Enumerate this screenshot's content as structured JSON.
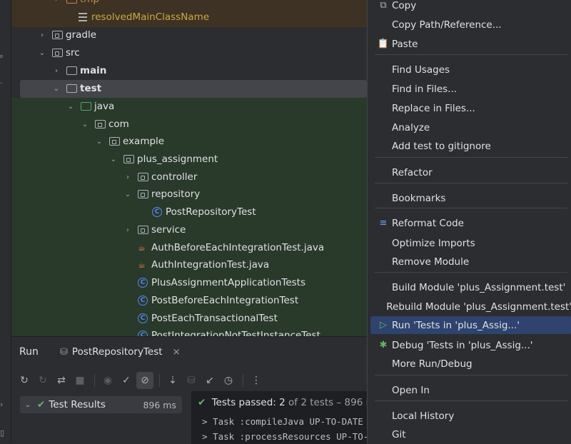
{
  "project_tree": {
    "rows": [
      {
        "name": "tree-row-tmp",
        "label": "tmp",
        "chev": "›",
        "icon": "folder-orange",
        "style": "orange"
      },
      {
        "name": "tree-row-resolvedmainclassname",
        "label": "resolvedMainClassName",
        "chev": "",
        "icon": "lines",
        "style": "yellow"
      },
      {
        "name": "tree-row-gradle",
        "label": "gradle",
        "chev": "›",
        "icon": "folder",
        "style": ""
      },
      {
        "name": "tree-row-src",
        "label": "src",
        "chev": "⌄",
        "icon": "folder",
        "style": ""
      },
      {
        "name": "tree-row-main",
        "label": "main",
        "chev": "›",
        "icon": "folder-plain",
        "style": "bold"
      },
      {
        "name": "tree-row-test",
        "label": "test",
        "chev": "⌄",
        "icon": "folder-plain",
        "style": "bold"
      },
      {
        "name": "tree-row-java",
        "label": "java",
        "chev": "⌄",
        "icon": "folder-green",
        "style": ""
      },
      {
        "name": "tree-row-com",
        "label": "com",
        "chev": "⌄",
        "icon": "folder",
        "style": ""
      },
      {
        "name": "tree-row-example",
        "label": "example",
        "chev": "⌄",
        "icon": "folder",
        "style": ""
      },
      {
        "name": "tree-row-plus-assignment",
        "label": "plus_assignment",
        "chev": "⌄",
        "icon": "folder",
        "style": ""
      },
      {
        "name": "tree-row-controller",
        "label": "controller",
        "chev": "›",
        "icon": "folder",
        "style": ""
      },
      {
        "name": "tree-row-repository",
        "label": "repository",
        "chev": "⌄",
        "icon": "folder",
        "style": ""
      },
      {
        "name": "tree-row-postrepositorytest",
        "label": "PostRepositoryTest",
        "chev": "",
        "icon": "class",
        "style": ""
      },
      {
        "name": "tree-row-service",
        "label": "service",
        "chev": "›",
        "icon": "folder",
        "style": ""
      },
      {
        "name": "tree-row-authbeforeeach",
        "label": "AuthBeforeEachIntegrationTest.java",
        "chev": "",
        "icon": "java",
        "style": ""
      },
      {
        "name": "tree-row-authintegration",
        "label": "AuthIntegrationTest.java",
        "chev": "",
        "icon": "java",
        "style": ""
      },
      {
        "name": "tree-row-plusassignmentapp",
        "label": "PlusAssignmentApplicationTests",
        "chev": "",
        "icon": "class",
        "style": ""
      },
      {
        "name": "tree-row-postbeforeeach",
        "label": "PostBeforeEachIntegrationTest",
        "chev": "",
        "icon": "class",
        "style": ""
      },
      {
        "name": "tree-row-posteachtransactional",
        "label": "PostEachTransactionalTest",
        "chev": "",
        "icon": "class",
        "style": ""
      },
      {
        "name": "tree-row-postintegrationnottest",
        "label": "PostIntegrationNotTestInstanceTest",
        "chev": "",
        "icon": "class",
        "style": ""
      }
    ]
  },
  "run_panel": {
    "title": "Run",
    "tab_label": "PostRepositoryTest",
    "test_results_label": "Test Results",
    "test_results_time": "896 ms",
    "passed_label": "Tests passed:",
    "passed_count": "2",
    "passed_rest": "of 2 tests – 896 ms",
    "console_lines": [
      "> Task :compileJava UP-TO-DATE",
      "> Task :processResources UP-TO-DATE"
    ]
  },
  "context_menu": {
    "items": [
      {
        "name": "menu-copy",
        "label": "Copy",
        "icon": "⧉"
      },
      {
        "name": "menu-copy-path",
        "label": "Copy Path/Reference...",
        "icon": ""
      },
      {
        "name": "menu-paste",
        "label": "Paste",
        "icon": "📋"
      },
      {
        "name": "menu-find-usages",
        "label": "Find Usages",
        "icon": ""
      },
      {
        "name": "menu-find-in-files",
        "label": "Find in Files...",
        "icon": ""
      },
      {
        "name": "menu-replace-in-files",
        "label": "Replace in Files...",
        "icon": ""
      },
      {
        "name": "menu-analyze",
        "label": "Analyze",
        "icon": ""
      },
      {
        "name": "menu-add-gitignore",
        "label": "Add test to gitignore",
        "icon": ""
      },
      {
        "name": "menu-refactor",
        "label": "Refactor",
        "icon": ""
      },
      {
        "name": "menu-bookmarks",
        "label": "Bookmarks",
        "icon": ""
      },
      {
        "name": "menu-reformat",
        "label": "Reformat Code",
        "icon": "≡"
      },
      {
        "name": "menu-optimize-imports",
        "label": "Optimize Imports",
        "icon": ""
      },
      {
        "name": "menu-remove-module",
        "label": "Remove Module",
        "icon": ""
      },
      {
        "name": "menu-build-module",
        "label": "Build Module 'plus_Assignment.test'",
        "icon": ""
      },
      {
        "name": "menu-rebuild-module",
        "label": "Rebuild Module 'plus_Assignment.test'",
        "icon": ""
      },
      {
        "name": "menu-run-tests",
        "label": "Run 'Tests in 'plus_Assig...'",
        "icon": "▷"
      },
      {
        "name": "menu-debug-tests",
        "label": "Debug 'Tests in 'plus_Assig...'",
        "icon": "✱"
      },
      {
        "name": "menu-more-run-debug",
        "label": "More Run/Debug",
        "icon": ""
      },
      {
        "name": "menu-open-in",
        "label": "Open In",
        "icon": ""
      },
      {
        "name": "menu-local-history",
        "label": "Local History",
        "icon": ""
      },
      {
        "name": "menu-git",
        "label": "Git",
        "icon": ""
      }
    ]
  }
}
